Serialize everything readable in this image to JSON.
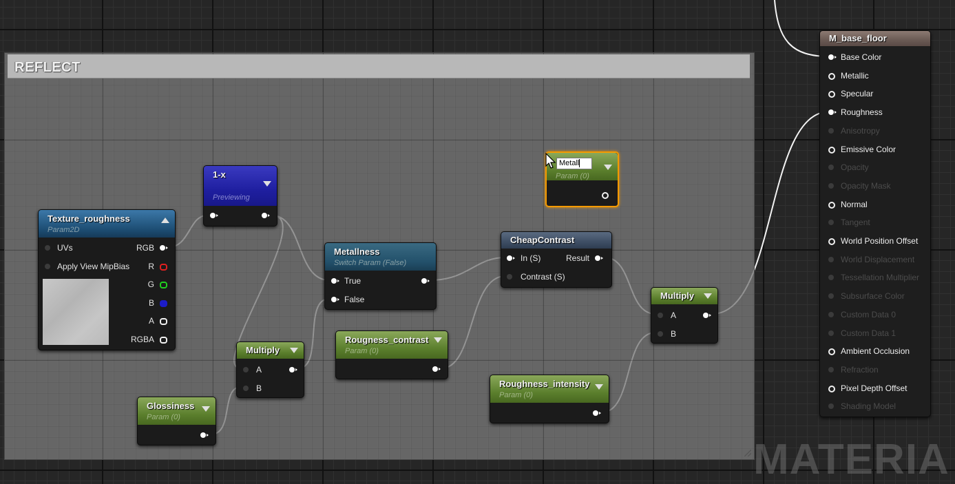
{
  "comment": {
    "title": "REFLECT"
  },
  "nodes": {
    "texture": {
      "title": "Texture_roughness",
      "subtitle": "Param2D",
      "pins": {
        "uvs": "UVs",
        "mipbias": "Apply View MipBias",
        "rgb": "RGB",
        "r": "R",
        "g": "G",
        "b": "B",
        "a": "A",
        "rgba": "RGBA"
      }
    },
    "one_minus": {
      "title": "1-x",
      "subtitle": "Previewing"
    },
    "metallness": {
      "title": "Metallness",
      "subtitle": "Switch Param (False)",
      "pins": {
        "true": "True",
        "false": "False"
      }
    },
    "cheap_contrast": {
      "title": "CheapContrast",
      "pins": {
        "in": "In (S)",
        "contrast": "Contrast (S)",
        "result": "Result"
      }
    },
    "metal_param": {
      "rename_value": "Metall",
      "subtitle": "Param (0)"
    },
    "multiply_left": {
      "title": "Multiply",
      "pins": {
        "a": "A",
        "b": "B"
      }
    },
    "multiply_right": {
      "title": "Multiply",
      "pins": {
        "a": "A",
        "b": "B"
      }
    },
    "roughness_contrast": {
      "title": "Rougness_contrast",
      "subtitle": "Param (0)"
    },
    "roughness_intensity": {
      "title": "Roughness_intensity",
      "subtitle": "Param (0)"
    },
    "glossiness": {
      "title": "Glossiness",
      "subtitle": "Param (0)"
    }
  },
  "result_node": {
    "title": "M_base_floor",
    "inputs": [
      {
        "label": "Base Color",
        "enabled": true,
        "connected": true
      },
      {
        "label": "Metallic",
        "enabled": true,
        "connected": false
      },
      {
        "label": "Specular",
        "enabled": true,
        "connected": false
      },
      {
        "label": "Roughness",
        "enabled": true,
        "connected": true
      },
      {
        "label": "Anisotropy",
        "enabled": false,
        "connected": false
      },
      {
        "label": "Emissive Color",
        "enabled": true,
        "connected": false
      },
      {
        "label": "Opacity",
        "enabled": false,
        "connected": false
      },
      {
        "label": "Opacity Mask",
        "enabled": false,
        "connected": false
      },
      {
        "label": "Normal",
        "enabled": true,
        "connected": false
      },
      {
        "label": "Tangent",
        "enabled": false,
        "connected": false
      },
      {
        "label": "World Position Offset",
        "enabled": true,
        "connected": false
      },
      {
        "label": "World Displacement",
        "enabled": false,
        "connected": false
      },
      {
        "label": "Tessellation Multiplier",
        "enabled": false,
        "connected": false
      },
      {
        "label": "Subsurface Color",
        "enabled": false,
        "connected": false
      },
      {
        "label": "Custom Data 0",
        "enabled": false,
        "connected": false
      },
      {
        "label": "Custom Data 1",
        "enabled": false,
        "connected": false
      },
      {
        "label": "Ambient Occlusion",
        "enabled": true,
        "connected": false
      },
      {
        "label": "Refraction",
        "enabled": false,
        "connected": false
      },
      {
        "label": "Pixel Depth Offset",
        "enabled": true,
        "connected": false
      },
      {
        "label": "Shading Model",
        "enabled": false,
        "connected": false
      }
    ]
  },
  "watermark": "MATERIA",
  "colors": {
    "selection": "#f59a00",
    "wire": "#ffffff",
    "param_header": "#5a7e2c",
    "texture_header": "#1d4e74",
    "one_minus_header": "#1f1fa0"
  }
}
